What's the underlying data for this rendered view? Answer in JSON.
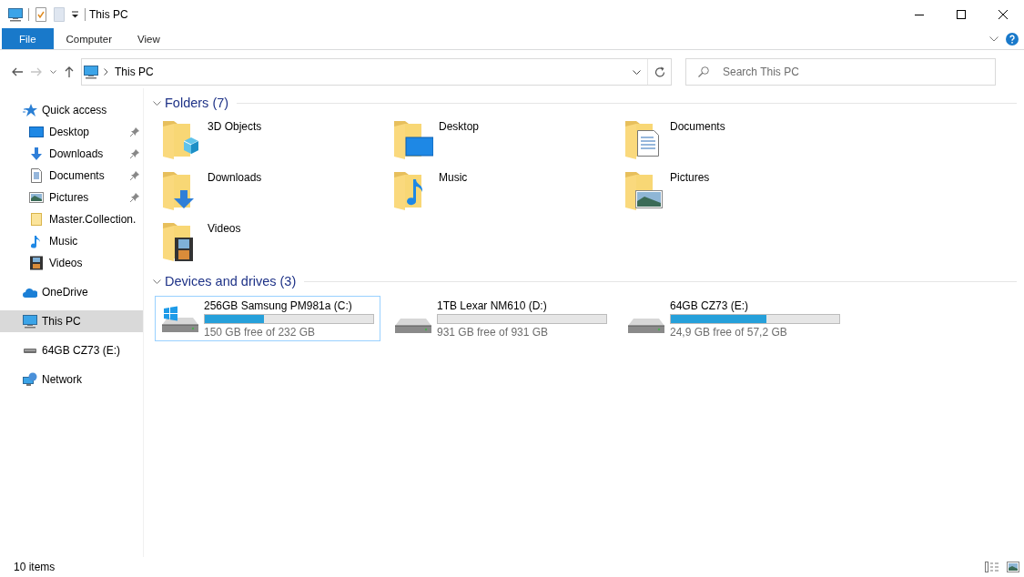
{
  "window": {
    "title": "This PC"
  },
  "ribbon": {
    "tabs": [
      {
        "label": "File",
        "selected": true
      },
      {
        "label": "Computer",
        "selected": false
      },
      {
        "label": "View",
        "selected": false
      }
    ]
  },
  "address": {
    "path": "This PC",
    "placeholder": "Search This PC"
  },
  "sidebar": {
    "items": [
      {
        "label": "Quick access",
        "children": [
          {
            "label": "Desktop",
            "pinned": true
          },
          {
            "label": "Downloads",
            "pinned": true
          },
          {
            "label": "Documents",
            "pinned": true
          },
          {
            "label": "Pictures",
            "pinned": true
          },
          {
            "label": "Master.Collection.",
            "pinned": false
          },
          {
            "label": "Music",
            "pinned": false
          },
          {
            "label": "Videos",
            "pinned": false
          }
        ]
      },
      {
        "label": "OneDrive",
        "selected": false
      },
      {
        "label": "This PC",
        "selected": true
      },
      {
        "label": "64GB CZ73 (E:)",
        "selected": false
      },
      {
        "label": "Network",
        "selected": false
      }
    ]
  },
  "groups": [
    {
      "title": "Folders (7)",
      "kind": "folders",
      "items": [
        {
          "label": "3D Objects"
        },
        {
          "label": "Desktop"
        },
        {
          "label": "Documents"
        },
        {
          "label": "Downloads"
        },
        {
          "label": "Music"
        },
        {
          "label": "Pictures"
        },
        {
          "label": "Videos"
        }
      ]
    },
    {
      "title": "Devices and drives (3)",
      "kind": "drives",
      "items": [
        {
          "label": "256GB Samsung PM981a (C:)",
          "kind": "system",
          "level": 0.35,
          "free": "150 GB free of 232 GB",
          "selected": true
        },
        {
          "label": "1TB Lexar NM610 (D:)",
          "kind": "disk",
          "level": 0,
          "free": "931 GB free of 931 GB",
          "selected": false
        },
        {
          "label": "64GB CZ73 (E:)",
          "kind": "disk",
          "level": 0.57,
          "free": "24,9 GB free of 57,2 GB",
          "selected": false
        }
      ]
    }
  ],
  "status_bar": {
    "text": "10 items"
  }
}
